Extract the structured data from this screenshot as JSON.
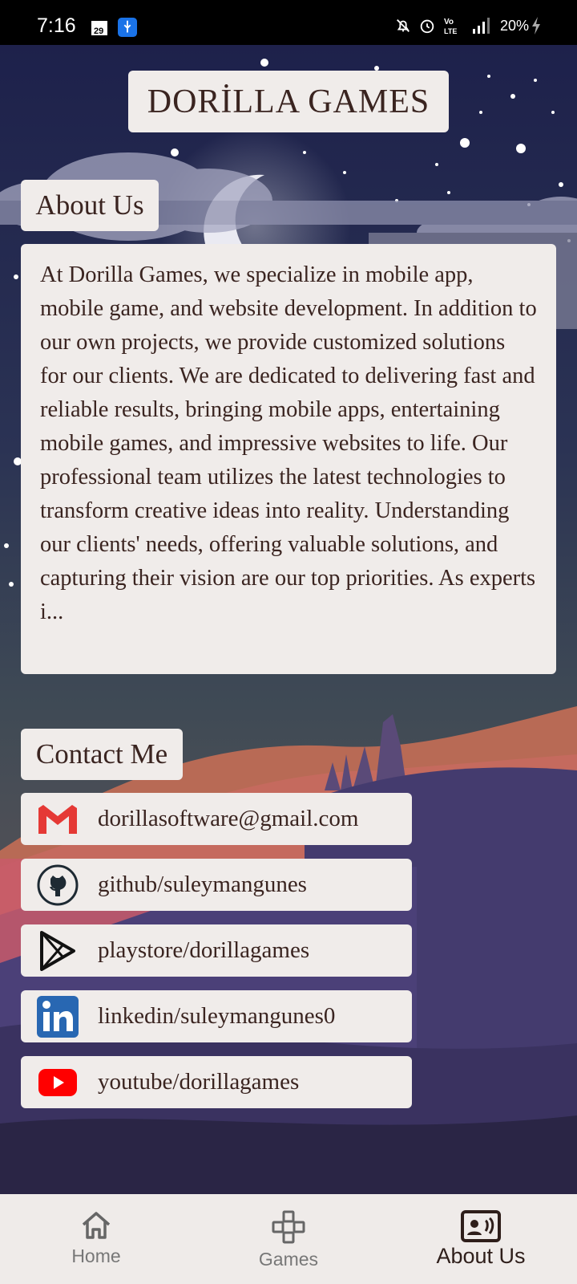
{
  "status_bar": {
    "time": "7:16",
    "battery": "20%",
    "icons": [
      "gallery-icon",
      "usb-icon",
      "mute-icon",
      "alarm-icon",
      "volte-icon",
      "signal-icon",
      "battery-charging-icon"
    ]
  },
  "header": {
    "title": "DORİLLA GAMES"
  },
  "about": {
    "label": "About Us",
    "text": "At Dorilla Games, we specialize in mobile app, mobile game, and website development. In addition to our own projects, we provide customized solutions for our clients. We are dedicated to delivering fast and reliable results, bringing mobile apps, entertaining mobile games, and impressive websites to life. Our professional team utilizes the latest technologies to transform creative ideas into reality. Understanding our clients' needs, offering valuable solutions, and capturing their vision are our top priorities. As experts i..."
  },
  "contact": {
    "label": "Contact Me",
    "items": [
      {
        "icon": "gmail-icon",
        "text": "dorillasoftware@gmail.com"
      },
      {
        "icon": "github-icon",
        "text": "github/suleymangunes"
      },
      {
        "icon": "playstore-icon",
        "text": "playstore/dorillagames"
      },
      {
        "icon": "linkedin-icon",
        "text": "linkedin/suleymangunes0"
      },
      {
        "icon": "youtube-icon",
        "text": "youtube/dorillagames"
      }
    ]
  },
  "bottom_nav": {
    "items": [
      {
        "label": "Home",
        "icon": "home-icon",
        "active": false
      },
      {
        "label": "Games",
        "icon": "gamepad-icon",
        "active": false
      },
      {
        "label": "About Us",
        "icon": "contact-card-icon",
        "active": true
      }
    ]
  },
  "colors": {
    "card": "#f0ecea",
    "text": "#3a2420",
    "sky_top": "#1c1f4a",
    "gmail_red": "#e53935",
    "linkedin_blue": "#2867b2",
    "youtube_red": "#ff0000"
  }
}
